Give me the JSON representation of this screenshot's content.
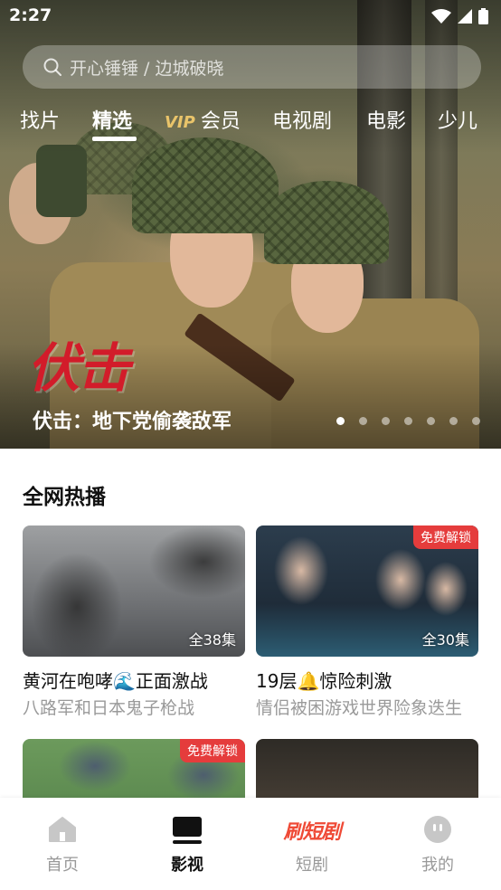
{
  "status_bar": {
    "time": "2:27"
  },
  "search": {
    "placeholder": "开心锤锤 / 边城破晓"
  },
  "category_tabs": [
    {
      "label": "找片"
    },
    {
      "label": "精选",
      "active": true
    },
    {
      "label": "会员",
      "prefix": "VIP"
    },
    {
      "label": "电视剧"
    },
    {
      "label": "电影"
    },
    {
      "label": "少儿"
    }
  ],
  "hero": {
    "logo_text": "伏击",
    "title": "伏击：地下党偷袭敌军",
    "dot_count": 7,
    "active_dot": 0
  },
  "section": {
    "title": "全网热播"
  },
  "cards": [
    {
      "title": "黄河在咆哮🌊正面激战",
      "subtitle": "八路军和日本鬼子枪战",
      "episodes": "全38集",
      "badge": ""
    },
    {
      "title": "19层🔔惊险刺激",
      "subtitle": "情侣被困游戏世界险象迭生",
      "episodes": "全30集",
      "badge": "免费解锁"
    },
    {
      "title": "",
      "subtitle": "",
      "episodes": "",
      "badge": "免费解锁"
    },
    {
      "title": "",
      "subtitle": "",
      "episodes": "",
      "badge": ""
    }
  ],
  "bottom_nav": [
    {
      "label": "首页",
      "icon": "home-icon"
    },
    {
      "label": "影视",
      "icon": "tv-icon",
      "active": true
    },
    {
      "label": "短剧",
      "icon": "short-drama-logo",
      "logo_text": "刷短剧"
    },
    {
      "label": "我的",
      "icon": "profile-icon"
    }
  ],
  "colors": {
    "accent_red": "#e53c3c",
    "logo_red": "#d21c2a"
  }
}
